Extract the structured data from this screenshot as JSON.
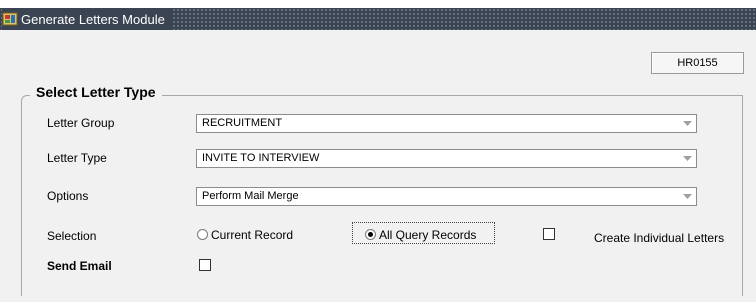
{
  "window": {
    "title": "Generate Letters Module",
    "icon": "oracle-forms-window-icon"
  },
  "form_code": "HR0155",
  "group": {
    "title": "Select Letter Type"
  },
  "fields": {
    "letter_group": {
      "label": "Letter Group",
      "value": "RECRUITMENT"
    },
    "letter_type": {
      "label": "Letter Type",
      "value": "INVITE TO INTERVIEW"
    },
    "options": {
      "label": "Options",
      "value": "Perform Mail Merge"
    }
  },
  "selection": {
    "label": "Selection",
    "current_record": {
      "label": "Current Record",
      "selected": false
    },
    "all_query_records": {
      "label": "All Query Records",
      "selected": true
    },
    "create_individual": {
      "label": "Create Individual Letters",
      "checked": false
    }
  },
  "send_email": {
    "label": "Send Email",
    "checked": false
  }
}
